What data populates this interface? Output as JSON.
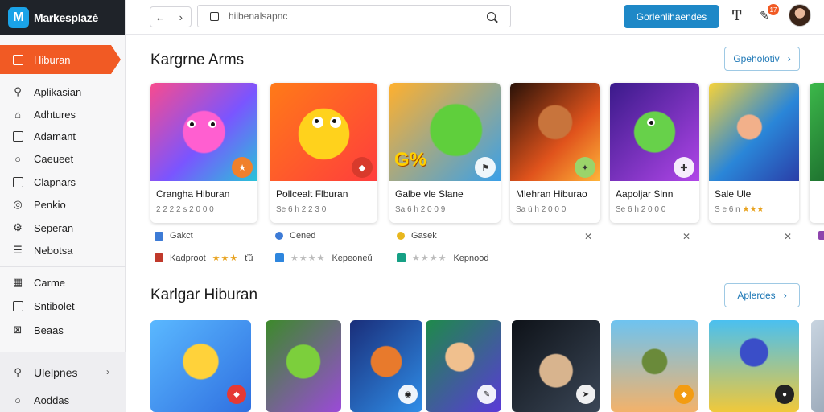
{
  "brand": {
    "logo_letter": "M",
    "name": "Markesplazé"
  },
  "sidebar": {
    "active": {
      "label": "Hiburan",
      "icon": "store-icon"
    },
    "items": [
      {
        "label": "Aplikasian",
        "icon": "search-icon"
      },
      {
        "label": "Adhtures",
        "icon": "tag-icon"
      },
      {
        "label": "Adamant",
        "icon": "document-icon"
      },
      {
        "label": "Caeueet",
        "icon": "circle-icon"
      },
      {
        "label": "Clapnars",
        "icon": "clipboard-icon"
      },
      {
        "label": "Penkio",
        "icon": "globe-icon"
      },
      {
        "label": "Seperan",
        "icon": "gear-icon"
      },
      {
        "label": "Nebotsa",
        "icon": "list-icon"
      }
    ],
    "items2": [
      {
        "label": "Carme",
        "icon": "grid-icon"
      },
      {
        "label": "Sntibolet",
        "icon": "chart-icon"
      },
      {
        "label": "Beaas",
        "icon": "close-box-icon"
      }
    ],
    "bottom": [
      {
        "label": "Ulelpnes",
        "icon": "search-icon"
      },
      {
        "label": "Aoddas",
        "icon": "info-icon"
      }
    ]
  },
  "topbar": {
    "search_value": "hiibenalsapnc",
    "cta_label": "Gorlenlihaendes",
    "notification_count": "17"
  },
  "section1": {
    "title": "Kargrne Arms",
    "button_label": "Gpeholotiv",
    "cards": [
      {
        "name": "Crangha Hiburan",
        "sub": "2 2 2 2 s 2 0 0 0",
        "stars": ""
      },
      {
        "name": "Pollcealt Flburan",
        "sub": "Se 6 h 2 2 3 0",
        "stars": ""
      },
      {
        "name": "Galbe vle Slane",
        "sub": "Sa 6 h 2 0 0 9",
        "stars": ""
      },
      {
        "name": "Mlehran Hiburao",
        "sub": "Sa ü h 2 0 0 0",
        "stars": ""
      },
      {
        "name": "Aapoljar Slnn",
        "sub": "Se 6 h 2 0 0 0",
        "stars": ""
      },
      {
        "name": "Sale Ule",
        "sub": "S e 6 n",
        "stars": "★★★"
      }
    ],
    "meta_row1": [
      {
        "label": "Gakct",
        "color": "#3d7bd6"
      },
      {
        "label": "Cened",
        "color": "#3d7bd6"
      },
      {
        "label": "Gasek",
        "color": "#e8b71e"
      }
    ],
    "meta_row2": [
      {
        "label": "Kadproot",
        "stars": "★★★",
        "extra": "ťŭ"
      },
      {
        "label": "Kepeoneŭ",
        "stars": "★★★★",
        "extra": ""
      },
      {
        "label": "Kepnood",
        "stars": "★★★★",
        "extra": ""
      }
    ],
    "x_marks": [
      "✕",
      "✕",
      "✕"
    ]
  },
  "section2": {
    "title": "Karlgar Hiburan",
    "button_label": "Aplerdes"
  }
}
